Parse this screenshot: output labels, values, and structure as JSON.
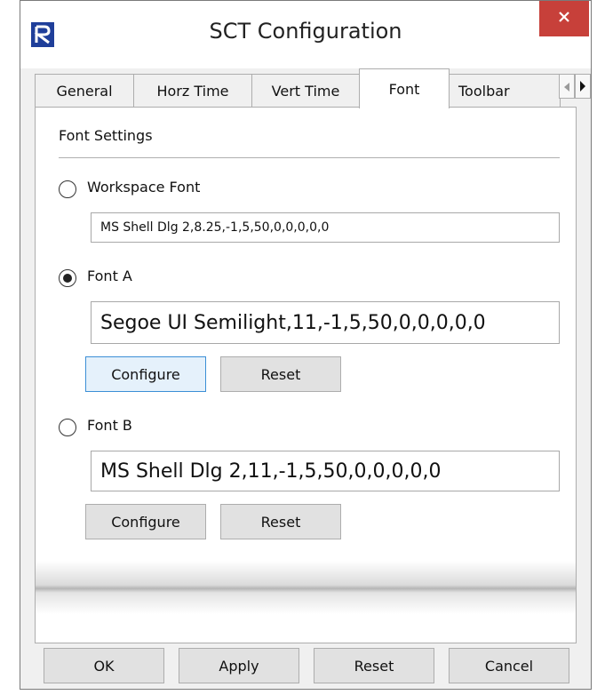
{
  "window": {
    "title": "SCT Configuration",
    "app_icon": "riverware-logo-icon",
    "close_icon": "close-icon"
  },
  "tabs": [
    {
      "label": "General",
      "active": false
    },
    {
      "label": "Horz Time",
      "active": false
    },
    {
      "label": "Vert Time",
      "active": false
    },
    {
      "label": "Font",
      "active": true
    },
    {
      "label": "Toolbar",
      "active": false
    }
  ],
  "tab_scroll": {
    "left_icon": "triangle-left-icon",
    "right_icon": "triangle-right-icon"
  },
  "font_settings": {
    "group_label": "Font Settings",
    "workspace_font": {
      "label": "Workspace Font",
      "selected": false,
      "value": "MS Shell Dlg 2,8.25,-1,5,50,0,0,0,0,0"
    },
    "font_a": {
      "label": "Font A",
      "selected": true,
      "value": "Segoe UI Semilight,11,-1,5,50,0,0,0,0,0",
      "configure_label": "Configure",
      "reset_label": "Reset"
    },
    "font_b": {
      "label": "Font B",
      "selected": false,
      "value": "MS Shell Dlg 2,11,-1,5,50,0,0,0,0,0",
      "configure_label": "Configure",
      "reset_label": "Reset"
    }
  },
  "footer": {
    "ok_label": "OK",
    "apply_label": "Apply",
    "reset_label": "Reset",
    "cancel_label": "Cancel"
  },
  "colors": {
    "close_button": "#c7403a",
    "focus_border": "#3c8fd6",
    "logo": "#1f3f9a"
  }
}
